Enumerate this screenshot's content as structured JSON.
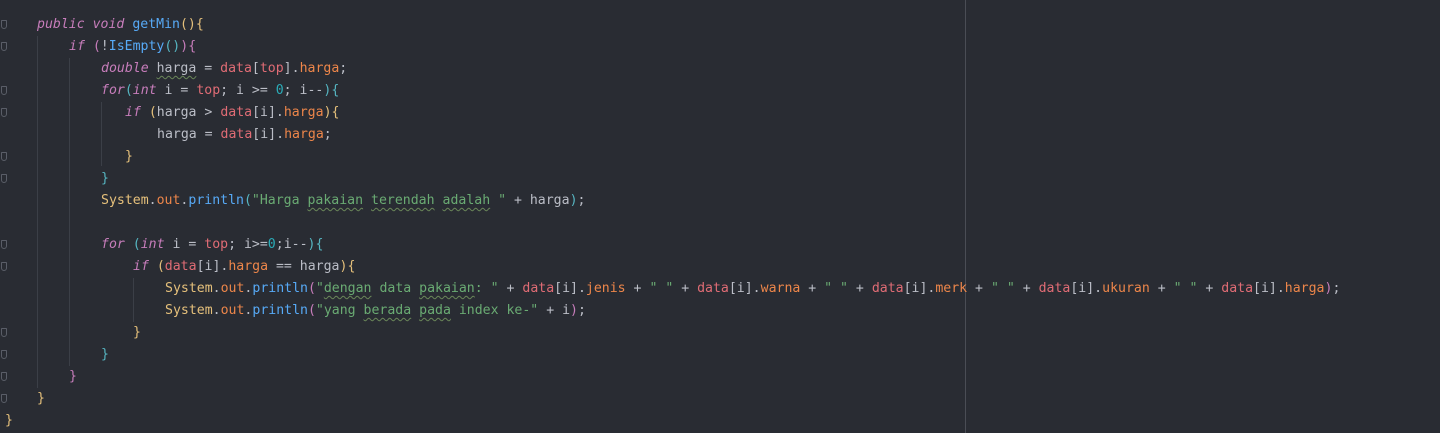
{
  "editor": {
    "lines": [
      {
        "tokens": [
          [
            "kw",
            "public"
          ],
          [
            "",
            " "
          ],
          [
            "kw",
            "void"
          ],
          [
            "",
            " "
          ],
          [
            "fn",
            "getMin"
          ],
          [
            "b1",
            "("
          ],
          [
            "b1",
            ")"
          ],
          [
            "b1",
            "{"
          ]
        ]
      },
      {
        "tokens": [
          [
            "kw",
            "if"
          ],
          [
            "",
            " "
          ],
          [
            "b2",
            "("
          ],
          [
            "",
            "!"
          ],
          [
            "fn",
            "IsEmpty"
          ],
          [
            "b3",
            "("
          ],
          [
            "b3",
            ")"
          ],
          [
            "b2",
            ")"
          ],
          [
            "b2",
            "{"
          ]
        ]
      },
      {
        "tokens": [
          [
            "kw",
            "double"
          ],
          [
            "",
            " "
          ],
          [
            "typo",
            "harga"
          ],
          [
            "",
            " = "
          ],
          [
            "var",
            "data"
          ],
          [
            "",
            "["
          ],
          [
            "var",
            "top"
          ],
          [
            "",
            "]."
          ],
          [
            "field",
            "harga"
          ],
          [
            "",
            ";"
          ]
        ]
      },
      {
        "tokens": [
          [
            "kw",
            "for"
          ],
          [
            "b3",
            "("
          ],
          [
            "kw",
            "int"
          ],
          [
            "",
            " i = "
          ],
          [
            "var",
            "top"
          ],
          [
            "",
            "; i >= "
          ],
          [
            "num",
            "0"
          ],
          [
            "",
            "; i--"
          ],
          [
            "b3",
            ")"
          ],
          [
            "b3",
            "{"
          ]
        ]
      },
      {
        "tokens": [
          [
            "kw",
            "if"
          ],
          [
            "",
            " "
          ],
          [
            "b1",
            "("
          ],
          [
            "",
            "harga > "
          ],
          [
            "var",
            "data"
          ],
          [
            "",
            "[i]."
          ],
          [
            "field",
            "harga"
          ],
          [
            "b1",
            ")"
          ],
          [
            "b1",
            "{"
          ]
        ]
      },
      {
        "tokens": [
          [
            "",
            "harga = "
          ],
          [
            "var",
            "data"
          ],
          [
            "",
            "[i]."
          ],
          [
            "field",
            "harga"
          ],
          [
            "",
            ";"
          ]
        ]
      },
      {
        "tokens": [
          [
            "b1",
            "}"
          ]
        ]
      },
      {
        "tokens": [
          [
            "b3",
            "}"
          ]
        ]
      },
      {
        "tokens": [
          [
            "cls",
            "System"
          ],
          [
            "",
            "."
          ],
          [
            "field",
            "out"
          ],
          [
            "",
            "."
          ],
          [
            "fn",
            "println"
          ],
          [
            "b3",
            "("
          ],
          [
            "str",
            "\"Harga "
          ],
          [
            "strtypo",
            "pakaian"
          ],
          [
            "str",
            " "
          ],
          [
            "strtypo",
            "terendah"
          ],
          [
            "str",
            " "
          ],
          [
            "strtypo",
            "adalah"
          ],
          [
            "str",
            " \""
          ],
          [
            "",
            " + harga"
          ],
          [
            "b3",
            ")"
          ],
          [
            "",
            ";"
          ]
        ]
      },
      {
        "tokens": []
      },
      {
        "tokens": [
          [
            "kw",
            "for"
          ],
          [
            "",
            " "
          ],
          [
            "b3",
            "("
          ],
          [
            "kw",
            "int"
          ],
          [
            "",
            " i = "
          ],
          [
            "var",
            "top"
          ],
          [
            "",
            "; i>="
          ],
          [
            "num",
            "0"
          ],
          [
            "",
            ";i--"
          ],
          [
            "b3",
            ")"
          ],
          [
            "b3",
            "{"
          ]
        ]
      },
      {
        "tokens": [
          [
            "kw",
            "if"
          ],
          [
            "",
            " "
          ],
          [
            "b1",
            "("
          ],
          [
            "var",
            "data"
          ],
          [
            "",
            "[i]."
          ],
          [
            "field",
            "harga"
          ],
          [
            "",
            " == harga"
          ],
          [
            "b1",
            ")"
          ],
          [
            "b1",
            "{"
          ]
        ]
      },
      {
        "tokens": [
          [
            "cls",
            "System"
          ],
          [
            "",
            "."
          ],
          [
            "field",
            "out"
          ],
          [
            "",
            "."
          ],
          [
            "fn",
            "println"
          ],
          [
            "b2",
            "("
          ],
          [
            "str",
            "\""
          ],
          [
            "strtypo",
            "dengan"
          ],
          [
            "str",
            " data "
          ],
          [
            "strtypo",
            "pakaian"
          ],
          [
            "str",
            ": \""
          ],
          [
            "",
            " + "
          ],
          [
            "var",
            "data"
          ],
          [
            "",
            "[i]."
          ],
          [
            "field",
            "jenis"
          ],
          [
            "",
            " + "
          ],
          [
            "str",
            "\" \""
          ],
          [
            "",
            " + "
          ],
          [
            "var",
            "data"
          ],
          [
            "",
            "[i]."
          ],
          [
            "field",
            "warna"
          ],
          [
            "",
            " + "
          ],
          [
            "str",
            "\" \""
          ],
          [
            "",
            " + "
          ],
          [
            "var",
            "data"
          ],
          [
            "",
            "[i]."
          ],
          [
            "field",
            "merk"
          ],
          [
            "",
            " + "
          ],
          [
            "str",
            "\" \""
          ],
          [
            "",
            " + "
          ],
          [
            "var",
            "data"
          ],
          [
            "",
            "[i]."
          ],
          [
            "field",
            "ukuran"
          ],
          [
            "",
            " + "
          ],
          [
            "str",
            "\" \""
          ],
          [
            "",
            " + "
          ],
          [
            "var",
            "data"
          ],
          [
            "",
            "[i]."
          ],
          [
            "field",
            "harga"
          ],
          [
            "b2",
            ")"
          ],
          [
            "",
            ";"
          ]
        ]
      },
      {
        "tokens": [
          [
            "cls",
            "System"
          ],
          [
            "",
            "."
          ],
          [
            "field",
            "out"
          ],
          [
            "",
            "."
          ],
          [
            "fn",
            "println"
          ],
          [
            "b2",
            "("
          ],
          [
            "str",
            "\"yang "
          ],
          [
            "strtypo",
            "berada"
          ],
          [
            "str",
            " "
          ],
          [
            "strtypo",
            "pada"
          ],
          [
            "str",
            " index ke-\""
          ],
          [
            "",
            " + i"
          ],
          [
            "b2",
            ")"
          ],
          [
            "",
            ";"
          ]
        ]
      },
      {
        "tokens": [
          [
            "b1",
            "}"
          ]
        ]
      },
      {
        "tokens": [
          [
            "b3",
            "}"
          ]
        ]
      },
      {
        "tokens": [
          [
            "b2",
            "}"
          ]
        ]
      },
      {
        "tokens": [
          [
            "b1",
            "}"
          ]
        ]
      },
      {
        "tokens": [
          [
            "b1",
            "}"
          ]
        ]
      }
    ]
  },
  "icons": {
    "fold_marker": "fold-marker-icon"
  },
  "colors": {
    "background": "#292c33",
    "keyword": "#c77dbb",
    "function": "#57aaf7",
    "field": "#ed864a",
    "variable": "#e06c75",
    "number": "#2aacb8",
    "string": "#6aab73",
    "class": "#e5c07b"
  }
}
